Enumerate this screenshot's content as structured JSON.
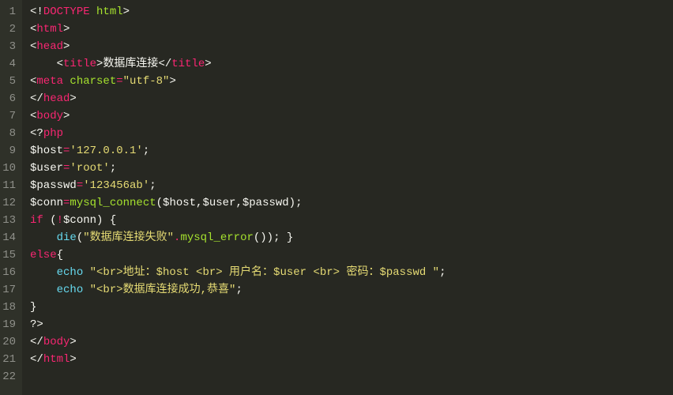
{
  "total_lines": 22,
  "code": {
    "l1": [
      {
        "cls": "punc",
        "t": "<!"
      },
      {
        "cls": "tag",
        "t": "DOCTYPE"
      },
      {
        "cls": "plain",
        "t": " "
      },
      {
        "cls": "attr",
        "t": "html"
      },
      {
        "cls": "punc",
        "t": ">"
      }
    ],
    "l2": [
      {
        "cls": "punc",
        "t": "<"
      },
      {
        "cls": "tag",
        "t": "html"
      },
      {
        "cls": "punc",
        "t": ">"
      }
    ],
    "l3": [
      {
        "cls": "punc",
        "t": "<"
      },
      {
        "cls": "tag",
        "t": "head"
      },
      {
        "cls": "punc",
        "t": ">"
      }
    ],
    "l4": [
      {
        "cls": "plain",
        "t": "    "
      },
      {
        "cls": "punc",
        "t": "<"
      },
      {
        "cls": "tag",
        "t": "title"
      },
      {
        "cls": "punc",
        "t": ">"
      },
      {
        "cls": "plain",
        "t": "数据库连接"
      },
      {
        "cls": "punc",
        "t": "</"
      },
      {
        "cls": "tag",
        "t": "title"
      },
      {
        "cls": "punc",
        "t": ">"
      }
    ],
    "l5": [
      {
        "cls": "punc",
        "t": "<"
      },
      {
        "cls": "tag",
        "t": "meta"
      },
      {
        "cls": "plain",
        "t": " "
      },
      {
        "cls": "attr",
        "t": "charset"
      },
      {
        "cls": "op",
        "t": "="
      },
      {
        "cls": "str",
        "t": "\"utf-8\""
      },
      {
        "cls": "punc",
        "t": ">"
      }
    ],
    "l6": [
      {
        "cls": "punc",
        "t": "</"
      },
      {
        "cls": "tag",
        "t": "head"
      },
      {
        "cls": "punc",
        "t": ">"
      }
    ],
    "l7": [
      {
        "cls": "punc",
        "t": "<"
      },
      {
        "cls": "tag",
        "t": "body"
      },
      {
        "cls": "punc",
        "t": ">"
      }
    ],
    "l8": [
      {
        "cls": "plain",
        "t": "<?"
      },
      {
        "cls": "tag",
        "t": "php"
      }
    ],
    "l9": [
      {
        "cls": "plain",
        "t": "$host"
      },
      {
        "cls": "op",
        "t": "="
      },
      {
        "cls": "str",
        "t": "'127.0.0.1'"
      },
      {
        "cls": "punc",
        "t": ";"
      }
    ],
    "l10": [
      {
        "cls": "plain",
        "t": "$user"
      },
      {
        "cls": "op",
        "t": "="
      },
      {
        "cls": "str",
        "t": "'root'"
      },
      {
        "cls": "punc",
        "t": ";"
      }
    ],
    "l11": [
      {
        "cls": "plain",
        "t": "$passwd"
      },
      {
        "cls": "op",
        "t": "="
      },
      {
        "cls": "str",
        "t": "'123456ab'"
      },
      {
        "cls": "punc",
        "t": ";"
      }
    ],
    "l12": [
      {
        "cls": "plain",
        "t": "$conn"
      },
      {
        "cls": "op",
        "t": "="
      },
      {
        "cls": "attr",
        "t": "mysql_connect"
      },
      {
        "cls": "plain",
        "t": "($host,$user,$passwd);"
      }
    ],
    "l13": [
      {
        "cls": "tag",
        "t": "if"
      },
      {
        "cls": "plain",
        "t": " ("
      },
      {
        "cls": "op",
        "t": "!"
      },
      {
        "cls": "plain",
        "t": "$conn) {"
      }
    ],
    "l14": [
      {
        "cls": "plain",
        "t": "    "
      },
      {
        "cls": "func",
        "t": "die"
      },
      {
        "cls": "plain",
        "t": "("
      },
      {
        "cls": "str",
        "t": "\"数据库连接失败\""
      },
      {
        "cls": "op",
        "t": "."
      },
      {
        "cls": "attr",
        "t": "mysql_error"
      },
      {
        "cls": "plain",
        "t": "()); }"
      }
    ],
    "l15": [
      {
        "cls": "tag",
        "t": "else"
      },
      {
        "cls": "plain",
        "t": "{"
      }
    ],
    "l16": [
      {
        "cls": "plain",
        "t": "    "
      },
      {
        "cls": "func",
        "t": "echo"
      },
      {
        "cls": "plain",
        "t": " "
      },
      {
        "cls": "str",
        "t": "\"<br>地址：$host <br> 用户名：$user <br> 密码：$passwd \""
      },
      {
        "cls": "punc",
        "t": ";"
      }
    ],
    "l17": [
      {
        "cls": "plain",
        "t": "    "
      },
      {
        "cls": "func",
        "t": "echo"
      },
      {
        "cls": "plain",
        "t": " "
      },
      {
        "cls": "str",
        "t": "\"<br>数据库连接成功,恭喜\""
      },
      {
        "cls": "punc",
        "t": ";"
      }
    ],
    "l18": [
      {
        "cls": "plain",
        "t": "}"
      }
    ],
    "l19": [
      {
        "cls": "plain",
        "t": "?>"
      }
    ],
    "l20": [
      {
        "cls": "punc",
        "t": "</"
      },
      {
        "cls": "tag",
        "t": "body"
      },
      {
        "cls": "punc",
        "t": ">"
      }
    ],
    "l21": [
      {
        "cls": "punc",
        "t": "</"
      },
      {
        "cls": "tag",
        "t": "html"
      },
      {
        "cls": "punc",
        "t": ">"
      }
    ],
    "l22": [
      {
        "cls": "plain",
        "t": ""
      }
    ]
  }
}
